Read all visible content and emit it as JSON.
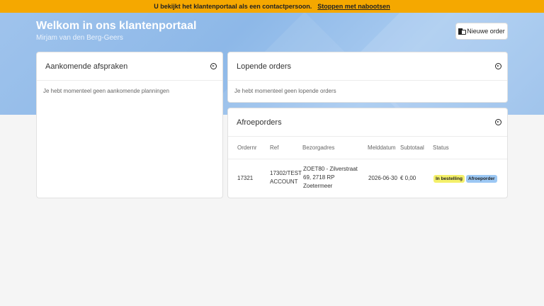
{
  "banner": {
    "message": "U bekijkt het klantenportaal als een contactpersoon.",
    "stop_label": "Stoppen met nabootsen"
  },
  "header": {
    "title": "Welkom in ons klantenportaal",
    "subtitle": "Mirjam van den Berg-Geers",
    "new_order_label": "Nieuwe order",
    "new_order_icon": "new-order-icon"
  },
  "appointments": {
    "title": "Aankomende afspraken",
    "empty_text": "Je hebt momenteel geen aankomende planningen",
    "icon": "arrow-circle-right-icon"
  },
  "orders": {
    "title": "Lopende orders",
    "empty_text": "Je hebt momenteel geen lopende orders",
    "icon": "arrow-circle-right-icon"
  },
  "callorders": {
    "title": "Afroeporders",
    "icon": "arrow-circle-right-icon",
    "columns": [
      "Ordernr",
      "Ref",
      "Bezorgadres",
      "Melddatum",
      "Subtotaal",
      "Status"
    ],
    "rows": [
      {
        "ordernr": "17321",
        "ref_line1": "17302/TEST",
        "ref_line2": "ACCOUNT",
        "address_line1": "ZOET80 - Zilverstraat",
        "address_line2": "69, 2718 RP",
        "address_line3": "Zoetermeer",
        "date": "2026-06-30",
        "subtotal": "€ 0,00",
        "status_badges": [
          "In bestelling",
          "Afroeporder"
        ]
      }
    ]
  },
  "colors": {
    "banner": "#f5a800",
    "hero": "#9fc3ec",
    "badge_yellow": "#f4f06a",
    "badge_blue": "#9cc8f4"
  }
}
